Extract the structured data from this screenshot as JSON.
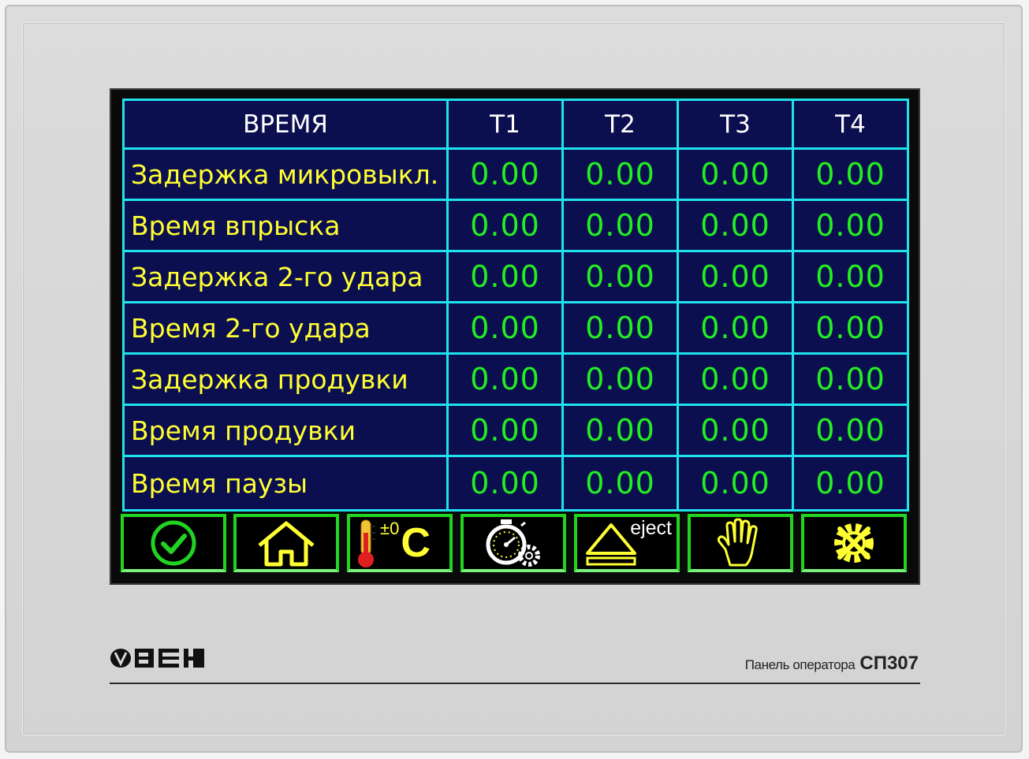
{
  "table": {
    "headers": [
      "ВРЕМЯ",
      "T1",
      "T2",
      "T3",
      "T4"
    ],
    "rows": [
      {
        "label": "Задержка микровыкл.",
        "values": [
          "0.00",
          "0.00",
          "0.00",
          "0.00"
        ]
      },
      {
        "label": "Время впрыска",
        "values": [
          "0.00",
          "0.00",
          "0.00",
          "0.00"
        ]
      },
      {
        "label": "Задержка 2-го удара",
        "values": [
          "0.00",
          "0.00",
          "0.00",
          "0.00"
        ]
      },
      {
        "label": "Время 2-го удара",
        "values": [
          "0.00",
          "0.00",
          "0.00",
          "0.00"
        ]
      },
      {
        "label": "Задержка продувки",
        "values": [
          "0.00",
          "0.00",
          "0.00",
          "0.00"
        ]
      },
      {
        "label": "Время продувки",
        "values": [
          "0.00",
          "0.00",
          "0.00",
          "0.00"
        ]
      },
      {
        "label": "Время паузы",
        "values": [
          "0.00",
          "0.00",
          "0.00",
          "0.00"
        ]
      }
    ]
  },
  "toolbar": {
    "buttons": [
      {
        "icon": "check-circle-icon"
      },
      {
        "icon": "home-icon"
      },
      {
        "icon": "thermometer-icon",
        "sign": "±0",
        "unit": "C"
      },
      {
        "icon": "timer-settings-icon"
      },
      {
        "icon": "eject-icon",
        "label": "eject"
      },
      {
        "icon": "hand-icon"
      },
      {
        "icon": "gear-wrench-icon"
      }
    ]
  },
  "footer": {
    "brand": "ОВЕН",
    "panel_label": "Панель оператора",
    "model": "СП307"
  },
  "colors": {
    "cell_bg": "#0c0f4f",
    "grid_line": "#1fe3ec",
    "label_text": "#ffff33",
    "value_text": "#22ee22",
    "header_text": "#ffffff",
    "button_border": "#22d322"
  }
}
